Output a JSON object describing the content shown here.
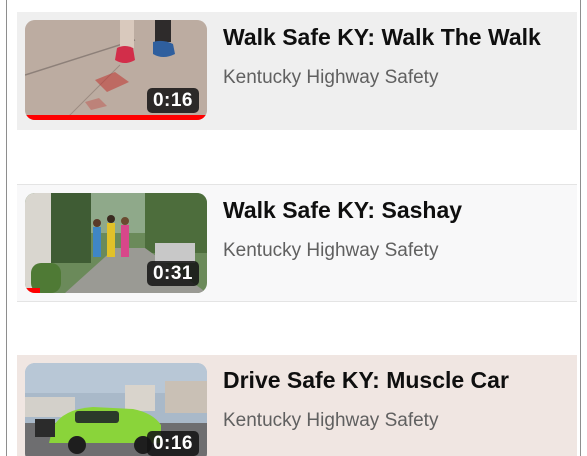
{
  "videos": [
    {
      "title": "Walk Safe KY: Walk The Walk",
      "channel": "Kentucky Highway Safety",
      "duration": "0:16",
      "watched_fraction": 1.0,
      "background": "#efefef"
    },
    {
      "title": "Walk Safe KY: Sashay",
      "channel": "Kentucky Highway Safety",
      "duration": "0:31",
      "watched_fraction": 0.08,
      "background": "#f8f8f9"
    },
    {
      "title": "Drive Safe KY: Muscle Car",
      "channel": "Kentucky Highway Safety",
      "duration": "0:16",
      "watched_fraction": 0.0,
      "background": "#f0e6e2"
    }
  ]
}
